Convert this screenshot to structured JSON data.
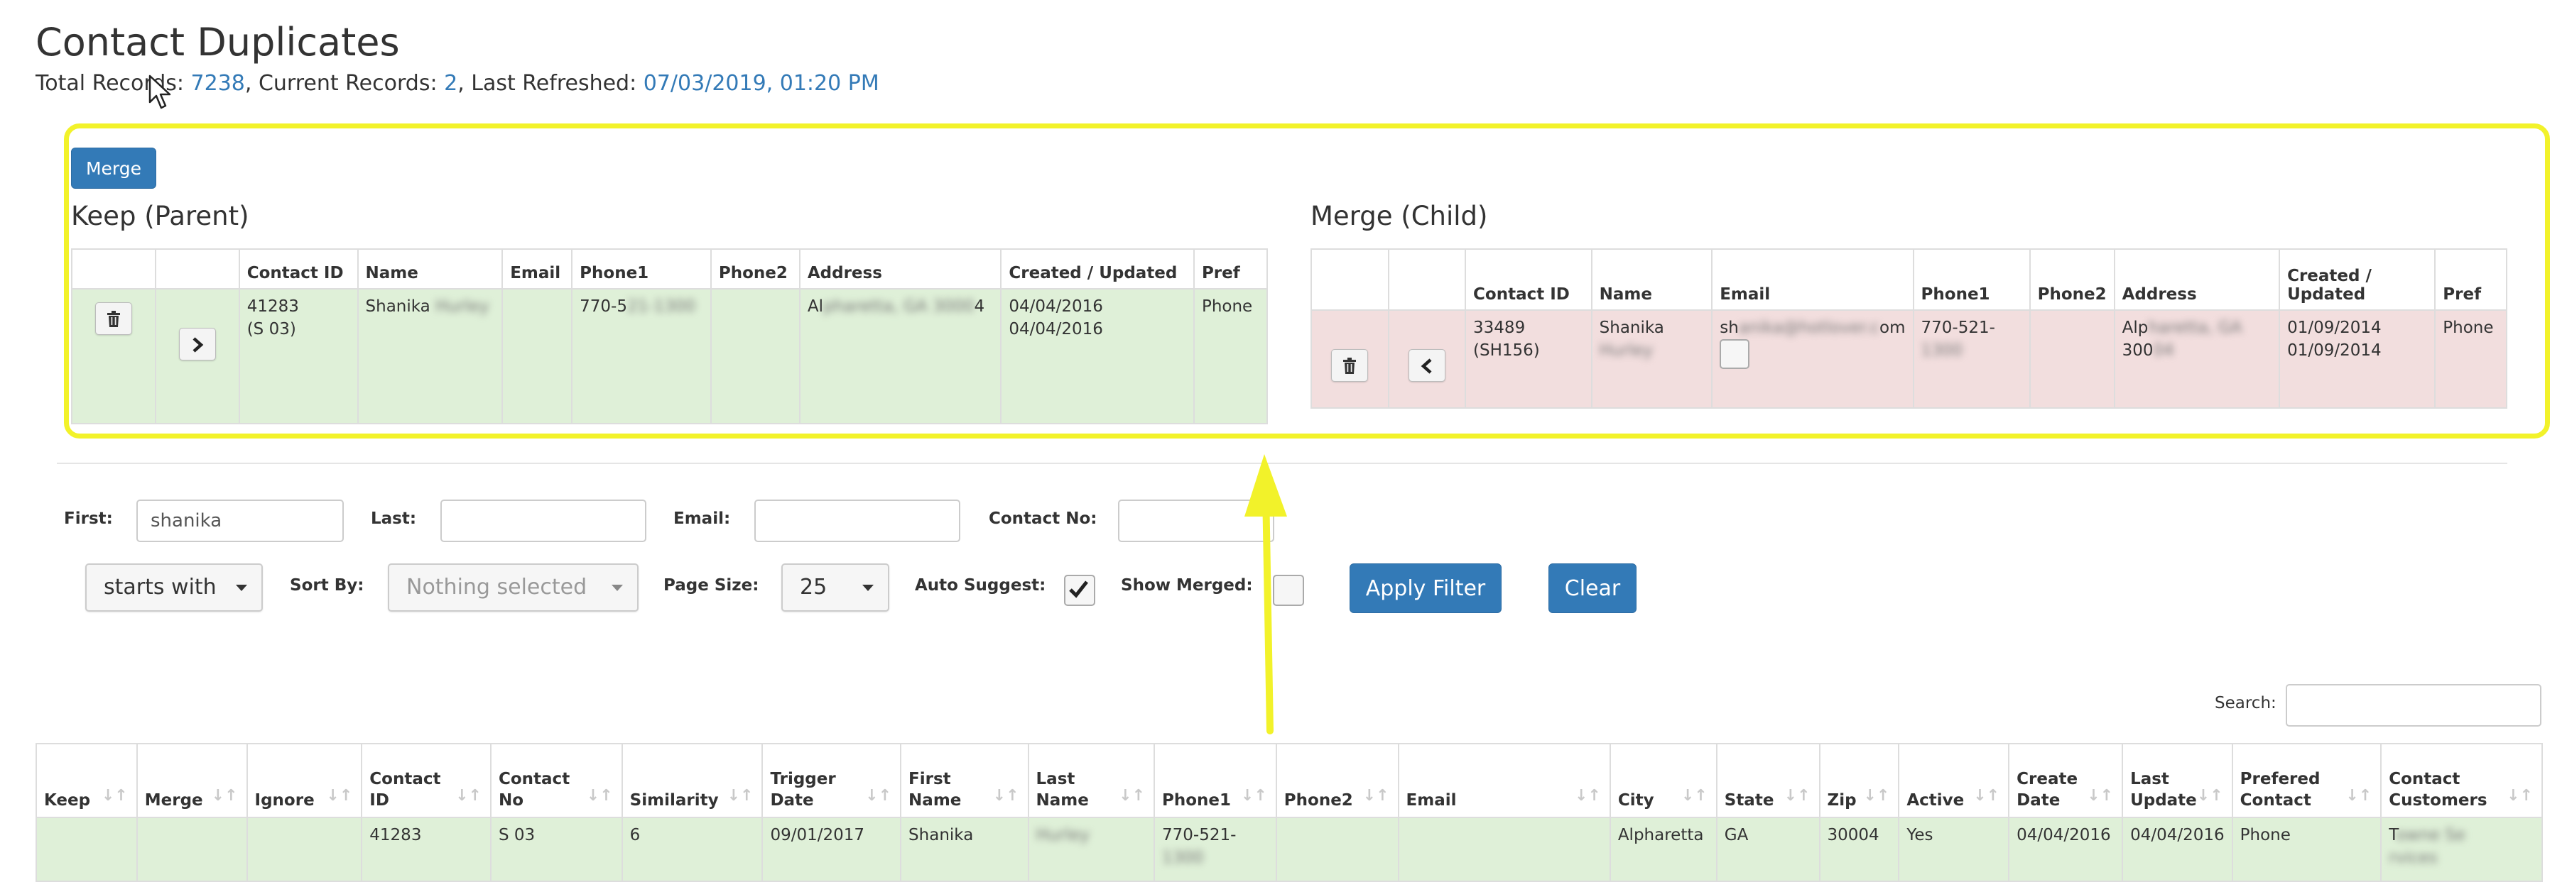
{
  "header": {
    "title": "Contact Duplicates",
    "stats": {
      "total_label": "Total Records: ",
      "total": "7238",
      "current_label": ", Current Records: ",
      "current": "2",
      "refreshed_label": ", Last Refreshed: ",
      "refreshed": "07/03/2019, 01:20 PM"
    }
  },
  "merge_panel": {
    "merge_button": "Merge",
    "keep": {
      "title": "Keep (Parent)",
      "columns": [
        "",
        "",
        "Contact ID",
        "Name",
        "Email",
        "Phone1",
        "Phone2",
        "Address",
        "Created / Updated",
        "Pref"
      ],
      "row": {
        "contact_id": "41283",
        "contact_no": "(S 03)",
        "name": "Shanika",
        "name_hidden": "Hurley",
        "email": "",
        "phone1": "770-5",
        "phone1_hidden": "21-1300",
        "phone2": "",
        "address": "Al",
        "address_hidden": "pharetta, GA 3000",
        "address_end": "4",
        "created": "04/04/2016",
        "updated": "04/04/2016",
        "pref": "Phone"
      }
    },
    "child": {
      "title": "Merge (Child)",
      "columns": [
        "",
        "",
        "Contact ID",
        "Name",
        "Email",
        "Phone1",
        "Phone2",
        "Address",
        "Created / Updated",
        "Pref"
      ],
      "row": {
        "contact_id": "33489",
        "contact_no": "(SH156)",
        "name": "Shanika",
        "name_hidden": "Hurley",
        "email": "sh",
        "email_hidden": "anika@hotlover.c",
        "email_end": "om",
        "phone1": "770-521-",
        "phone1_hidden": "1300",
        "phone2": "",
        "address": "Alp",
        "address_hidden": "haretta, GA",
        "address2": "300",
        "address2_hidden": "04",
        "created": "01/09/2014",
        "updated": "01/09/2014",
        "pref": "Phone"
      }
    }
  },
  "filters": {
    "first_label": "First:",
    "first_value": "shanika",
    "last_label": "Last:",
    "last_value": "",
    "email_label": "Email:",
    "email_value": "",
    "contact_no_label": "Contact No:",
    "contact_no_value": "",
    "match_mode": "starts with",
    "sort_by_label": "Sort By:",
    "sort_by_placeholder": "Nothing selected",
    "page_size_label": "Page Size:",
    "page_size": "25",
    "auto_suggest_label": "Auto Suggest:",
    "auto_suggest_checked": true,
    "show_merged_label": "Show Merged:",
    "show_merged_checked": false,
    "apply_button": "Apply Filter",
    "clear_button": "Clear"
  },
  "grid": {
    "search_label": "Search:",
    "search_value": "",
    "columns": [
      {
        "l1": "Keep",
        "l2": ""
      },
      {
        "l1": "Merge",
        "l2": ""
      },
      {
        "l1": "Ignore",
        "l2": ""
      },
      {
        "l1": "Contact",
        "l2": "ID"
      },
      {
        "l1": "Contact",
        "l2": "No"
      },
      {
        "l1": "Similarity",
        "l2": ""
      },
      {
        "l1": "Trigger",
        "l2": "Date"
      },
      {
        "l1": "First",
        "l2": "Name"
      },
      {
        "l1": "Last",
        "l2": "Name"
      },
      {
        "l1": "Phone1",
        "l2": ""
      },
      {
        "l1": "Phone2",
        "l2": ""
      },
      {
        "l1": "Email",
        "l2": ""
      },
      {
        "l1": "City",
        "l2": ""
      },
      {
        "l1": "State",
        "l2": ""
      },
      {
        "l1": "Zip",
        "l2": ""
      },
      {
        "l1": "Active",
        "l2": ""
      },
      {
        "l1": "Create",
        "l2": "Date"
      },
      {
        "l1": "Last",
        "l2": "Update"
      },
      {
        "l1": "Prefered",
        "l2": "Contact"
      },
      {
        "l1": "Contact",
        "l2": "Customers"
      }
    ],
    "rows": [
      {
        "keep": "",
        "merge": "",
        "ignore": "",
        "contact_id": "41283",
        "contact_no": "S 03",
        "similarity": "6",
        "trigger_date": "09/01/2017",
        "first_name": "Shanika",
        "last_name_hidden": "Hurley",
        "phone1": "770-521-",
        "phone1_hidden": "1300",
        "phone2": "",
        "email": "",
        "city": "Alpharetta",
        "state": "GA",
        "zip": "30004",
        "active": "Yes",
        "create_date": "04/04/2016",
        "last_update": "04/04/2016",
        "prefered_contact": "Phone",
        "customers": "T",
        "customers_hidden": "owne Se",
        "customers2_hidden": "rvices"
      }
    ]
  },
  "colors": {
    "accent": "#337ab7",
    "highlight": "#f2f22a",
    "keep_row": "#dff0d8",
    "child_row": "#f2dede"
  },
  "icons": [
    "cursor-icon",
    "trash-icon",
    "chevron-right-icon",
    "chevron-left-icon",
    "caret-down-icon",
    "check-icon",
    "sort-icon",
    "annotation-arrow-icon"
  ]
}
